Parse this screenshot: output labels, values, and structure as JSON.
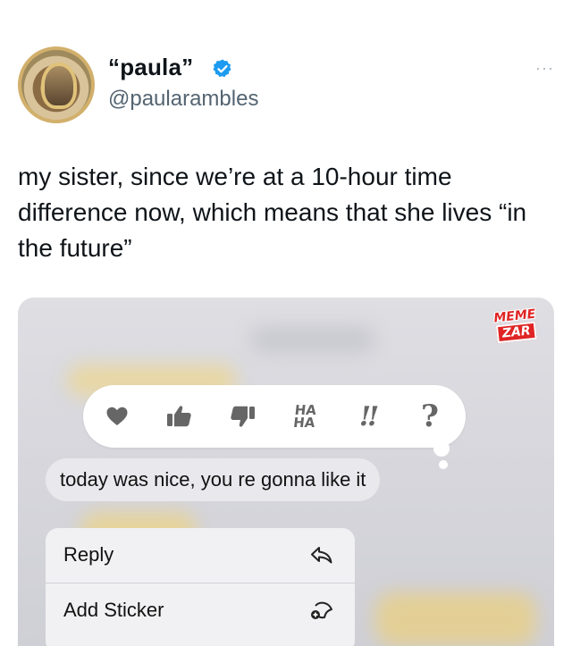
{
  "tweet": {
    "display_name": "“paula”",
    "handle": "@paularambles",
    "more_menu": "···",
    "verified_color": "#1d9bf0",
    "text": "my sister, since we’re at a 10-hour time difference now, which means that she lives “in the future”"
  },
  "media": {
    "watermark": {
      "line1": "MEME",
      "line2": "ZAR",
      "color": "#e02424"
    },
    "reactions": [
      {
        "name": "heart",
        "icon": "heart-icon"
      },
      {
        "name": "like",
        "icon": "thumbs-up-icon"
      },
      {
        "name": "dislike",
        "icon": "thumbs-down-icon"
      },
      {
        "name": "haha",
        "label_top": "HA",
        "label_bottom": "HA"
      },
      {
        "name": "emphasize",
        "label": "!!"
      },
      {
        "name": "question",
        "label": "?"
      }
    ],
    "message_bubble": "today was nice, you re gonna like it",
    "context_menu": {
      "items": [
        {
          "label": "Reply",
          "icon": "reply-arrow-icon"
        },
        {
          "label": "Add Sticker",
          "icon": "add-sticker-icon"
        }
      ]
    }
  }
}
